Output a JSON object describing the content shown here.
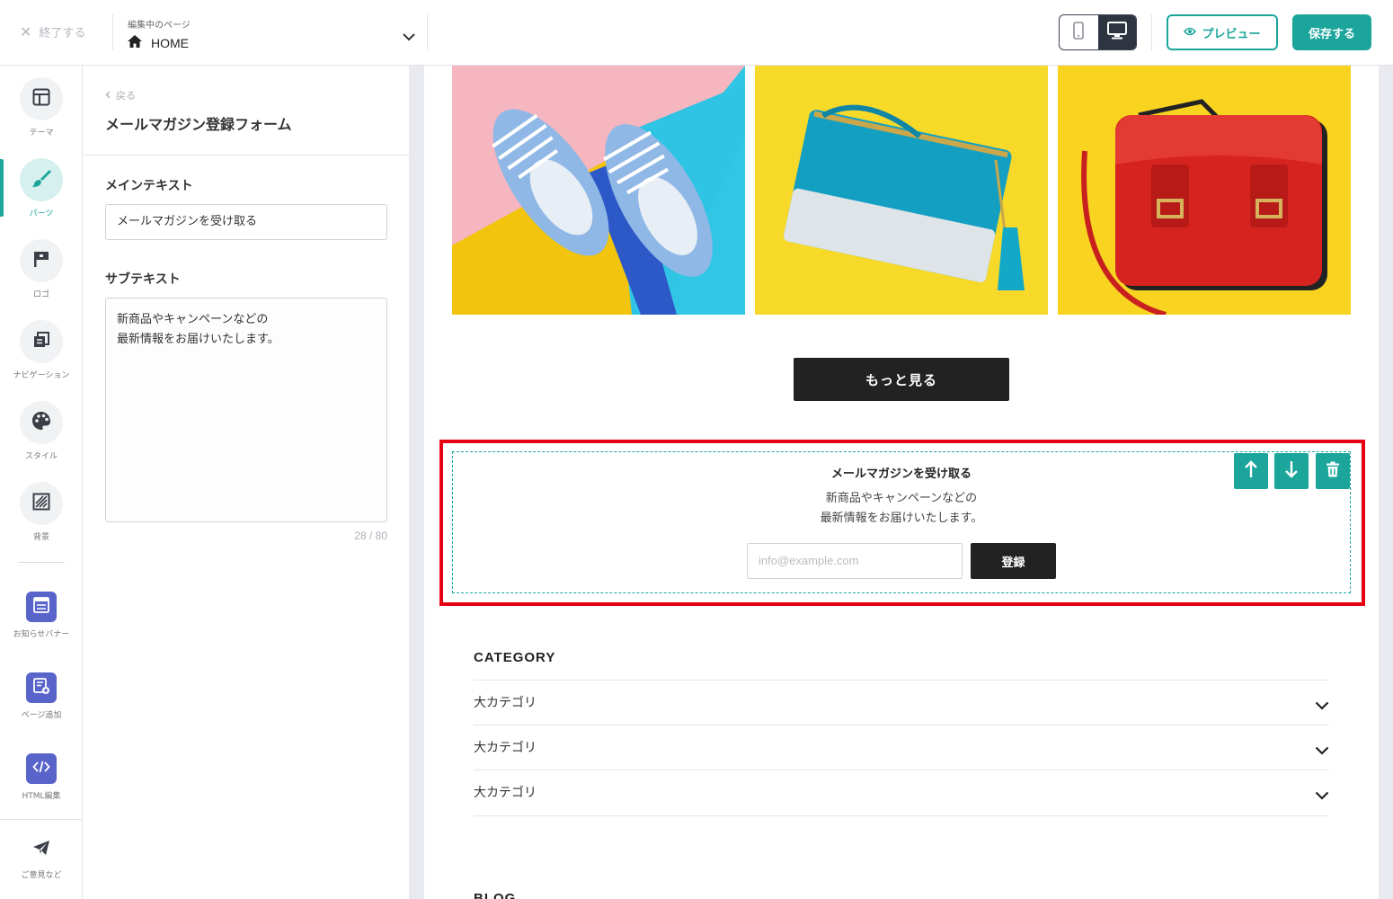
{
  "topbar": {
    "exit_label": "終了する",
    "page_caption": "編集中のページ",
    "page_name": "HOME",
    "preview_label": "プレビュー",
    "save_label": "保存する"
  },
  "rail": {
    "items": [
      {
        "label": "テーマ",
        "icon": "layout-icon"
      },
      {
        "label": "パーツ",
        "icon": "brush-icon"
      },
      {
        "label": "ロゴ",
        "icon": "flag-icon"
      },
      {
        "label": "ナビゲーション",
        "icon": "navigation-icon"
      },
      {
        "label": "スタイル",
        "icon": "palette-icon"
      },
      {
        "label": "背景",
        "icon": "background-icon"
      },
      {
        "label": "お知らせバナー",
        "icon": "banner-icon"
      },
      {
        "label": "ページ追加",
        "icon": "add-page-icon"
      },
      {
        "label": "HTML編集",
        "icon": "code-icon"
      },
      {
        "label": "ご意見など",
        "icon": "send-icon"
      }
    ]
  },
  "panel": {
    "back_label": "戻る",
    "title": "メールマガジン登録フォーム",
    "main_text_label": "メインテキスト",
    "main_text_value": "メールマガジンを受け取る",
    "sub_text_label": "サブテキスト",
    "sub_text_value": "新商品やキャンペーンなどの\n最新情報をお届けいたします。",
    "char_count": "28 / 80"
  },
  "canvas": {
    "more_button": "もっと見る",
    "newsletter": {
      "title": "メールマガジンを受け取る",
      "sub": "新商品やキャンペーンなどの\n最新情報をお届けいたします。",
      "email_placeholder": "info@example.com",
      "submit_label": "登録"
    },
    "category": {
      "heading": "CATEGORY",
      "rows": [
        "大カテゴリ",
        "大カテゴリ",
        "大カテゴリ"
      ]
    },
    "blog_heading": "BLOG"
  },
  "colors": {
    "accent": "#1ba59b",
    "selection": "#e60012",
    "dark": "#222222",
    "rail_purple": "#5864c9"
  }
}
